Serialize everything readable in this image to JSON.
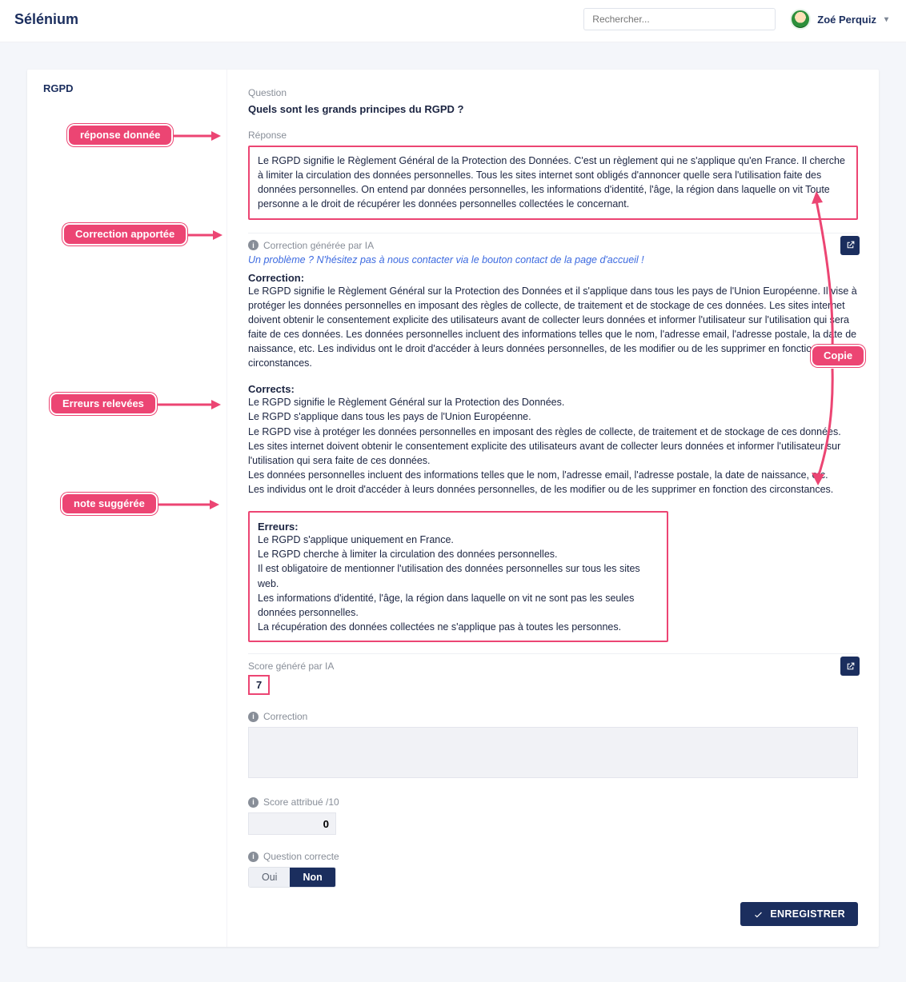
{
  "header": {
    "brand": "Sélénium",
    "search_placeholder": "Rechercher...",
    "user_name": "Zoé Perquiz"
  },
  "sidebar": {
    "title": "RGPD"
  },
  "labels": {
    "question": "Question",
    "reponse": "Réponse",
    "ai_correction": "Correction générée par IA",
    "ai_score": "Score généré par IA",
    "correction_field": "Correction",
    "score_field": "Score attribué /10",
    "question_correct": "Question correcte",
    "oui": "Oui",
    "non": "Non",
    "save": "ENREGISTRER"
  },
  "question_text": "Quels sont les grands principes du RGPD ?",
  "response_text": "Le RGPD signifie le Règlement Général de la Protection des Données. C'est un règlement qui ne s'applique qu'en France. Il cherche à limiter la circulation des données personnelles. Tous les sites internet sont obligés d'annoncer quelle sera l'utilisation faite des données personnelles. On entend par données personnelles, les informations d'identité, l'âge, la région dans laquelle on vit Toute personne a le droit de récupérer les données personnelles collectées le concernant.",
  "notice": "Un problème ? N'hésitez pas à nous contacter via le bouton contact de la page d'accueil !",
  "correction": {
    "title": "Correction:",
    "body": "Le RGPD signifie le Règlement Général sur la Protection des Données et il s'applique dans tous les pays de l'Union Européenne. Il vise à protéger les données personnelles en imposant des règles de collecte, de traitement et de stockage de ces données. Les sites internet doivent obtenir le consentement explicite des utilisateurs avant de collecter leurs données et informer l'utilisateur sur l'utilisation qui sera faite de ces données. Les données personnelles incluent des informations telles que le nom, l'adresse email, l'adresse postale, la date de naissance, etc. Les individus ont le droit d'accéder à leurs données personnelles, de les modifier ou de les supprimer en fonction des circonstances."
  },
  "corrects": {
    "title": "Corrects:",
    "body": "Le RGPD signifie le Règlement Général sur la Protection des Données.\nLe RGPD s'applique dans tous les pays de l'Union Européenne.\nLe RGPD vise à protéger les données personnelles en imposant des règles de collecte, de traitement et de stockage de ces données.\nLes sites internet doivent obtenir le consentement explicite des utilisateurs avant de collecter leurs données et informer l'utilisateur sur l'utilisation qui sera faite de ces données.\nLes données personnelles incluent des informations telles que le nom, l'adresse email, l'adresse postale, la date de naissance, etc.\nLes individus ont le droit d'accéder à leurs données personnelles, de les modifier ou de les supprimer en fonction des circonstances."
  },
  "errors": {
    "title": "Erreurs:",
    "body": "Le RGPD s'applique uniquement en France.\nLe RGPD cherche à limiter la circulation des données personnelles.\nIl est obligatoire de mentionner l'utilisation des données personnelles sur tous les sites web.\nLes informations d'identité, l'âge, la région dans laquelle on vit ne sont pas les seules données personnelles.\nLa récupération des données collectées ne s'applique pas à toutes les personnes."
  },
  "ai_score": "7",
  "form": {
    "correction_value": "",
    "score_value": "0",
    "correct_selected": "Non"
  },
  "annotations": {
    "resp": "réponse donnée",
    "corr": "Correction apportée",
    "err": "Erreurs relevées",
    "note": "note suggérée",
    "copy": "Copie"
  }
}
